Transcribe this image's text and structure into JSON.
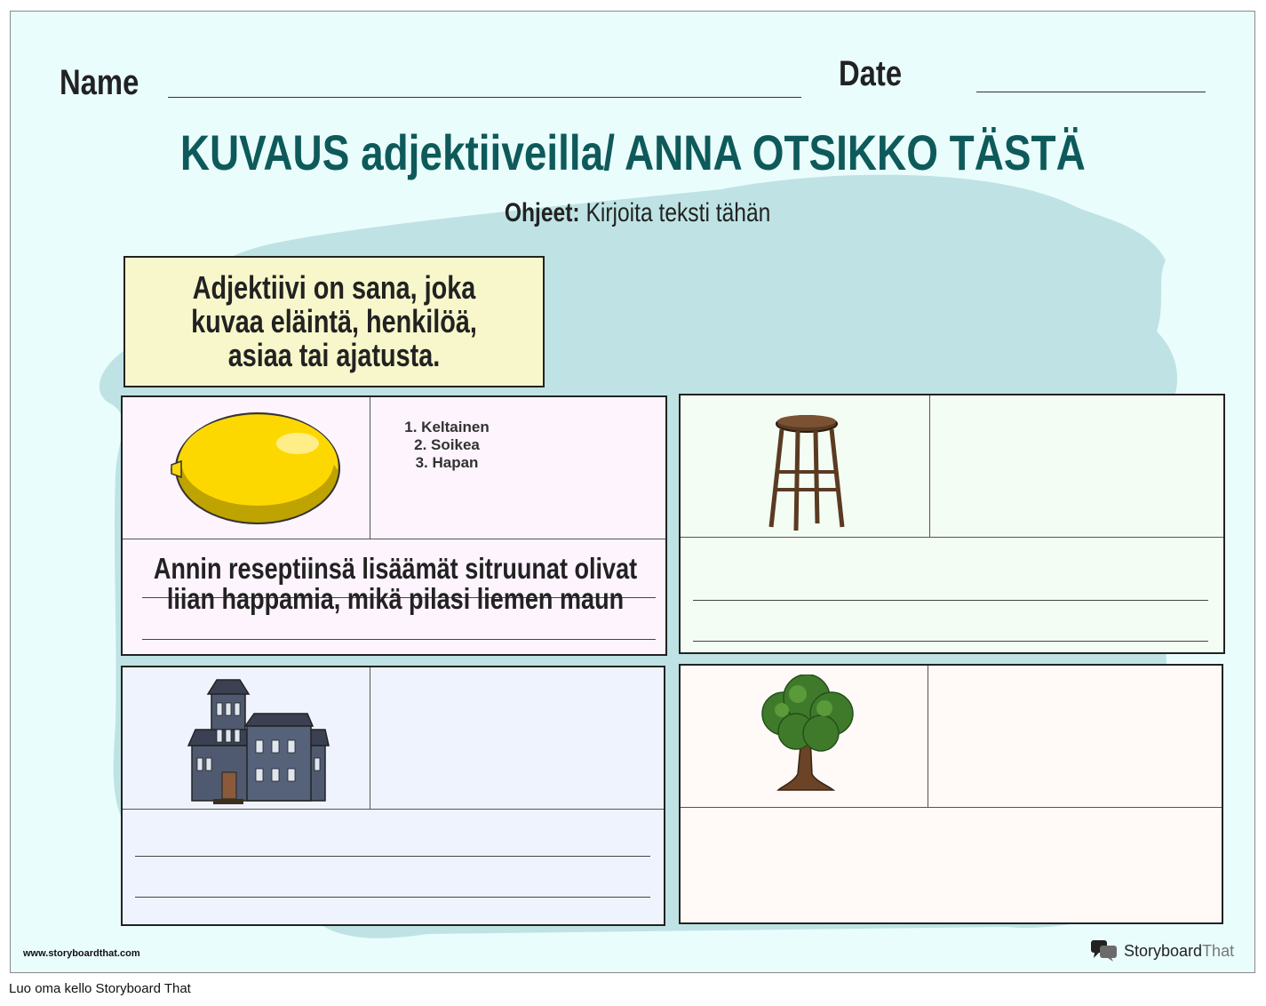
{
  "header": {
    "name_label": "Name",
    "date_label": "Date"
  },
  "title": "KUVAUS adjektiiveilla/ ANNA OTSIKKO TÄSTÄ",
  "instructions": {
    "label": "Ohjeet:",
    "text": "Kirjoita teksti tähän"
  },
  "definition": "Adjektiivi on sana, joka kuvaa eläintä, henkilöä, asiaa tai ajatusta.",
  "cards": [
    {
      "image": "lemon-image",
      "adjectives": [
        "1. Keltainen",
        "2. Soikea",
        "3. Hapan"
      ],
      "sentence": "Annin reseptiinsä lisäämät sitruunat olivat liian happamia, mikä pilasi liemen maun"
    },
    {
      "image": "stool-image"
    },
    {
      "image": "house-image"
    },
    {
      "image": "tree-image"
    }
  ],
  "footer": {
    "url": "www.storyboardthat.com",
    "brand_main": "Storyboard",
    "brand_light": "That",
    "brand_icon": "speech-bubbles-icon"
  },
  "caption": "Luo oma kello Storyboard That",
  "colors": {
    "title": "#0e5a5a",
    "background": "#eafdfd",
    "blob": "#bfe3e4",
    "definition_box": "#f7f7cb"
  }
}
